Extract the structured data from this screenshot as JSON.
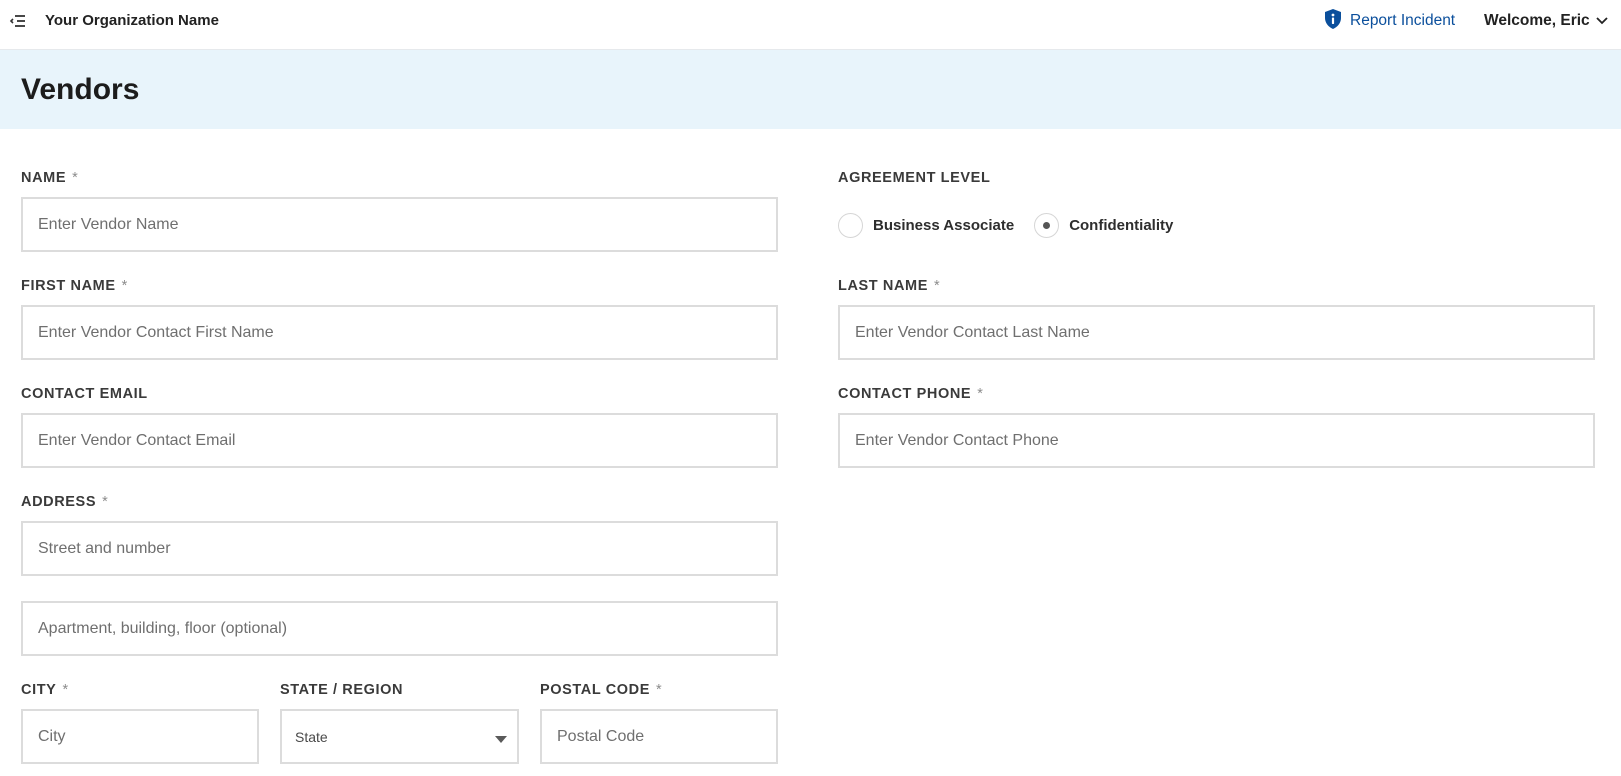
{
  "topbar": {
    "org_name": "Your Organization Name",
    "report_label": "Report Incident",
    "welcome_label": "Welcome, Eric",
    "accent_color": "#0b4f9c"
  },
  "header": {
    "title": "Vendors",
    "background_color": "#e8f4fb"
  },
  "form": {
    "name": {
      "label": "NAME",
      "required_mark": "*",
      "placeholder": "Enter Vendor Name",
      "value": ""
    },
    "agreement": {
      "label": "AGREEMENT LEVEL",
      "options": [
        {
          "label": "Business Associate",
          "selected": false
        },
        {
          "label": "Confidentiality",
          "selected": true
        }
      ]
    },
    "first_name": {
      "label": "FIRST NAME",
      "required_mark": "*",
      "placeholder": "Enter Vendor Contact First Name",
      "value": ""
    },
    "last_name": {
      "label": "LAST NAME",
      "required_mark": "*",
      "placeholder": "Enter Vendor Contact Last Name",
      "value": ""
    },
    "email": {
      "label": "CONTACT EMAIL",
      "placeholder": "Enter Vendor Contact Email",
      "value": ""
    },
    "phone": {
      "label": "CONTACT PHONE",
      "required_mark": "*",
      "placeholder": "Enter Vendor Contact Phone",
      "value": ""
    },
    "address": {
      "label": "ADDRESS",
      "required_mark": "*",
      "line1_placeholder": "Street and number",
      "line2_placeholder": "Apartment, building, floor (optional)"
    },
    "city": {
      "label": "CITY",
      "required_mark": "*",
      "placeholder": "City",
      "value": ""
    },
    "state": {
      "label": "STATE / REGION",
      "selected": "State"
    },
    "postal": {
      "label": "POSTAL CODE",
      "required_mark": "*",
      "placeholder": "Postal Code",
      "value": ""
    }
  },
  "icons": {
    "menu": "menu-collapse-icon",
    "report": "shield-info-icon",
    "welcome": "chevron-down-icon",
    "state_select": "caret-down-icon"
  }
}
